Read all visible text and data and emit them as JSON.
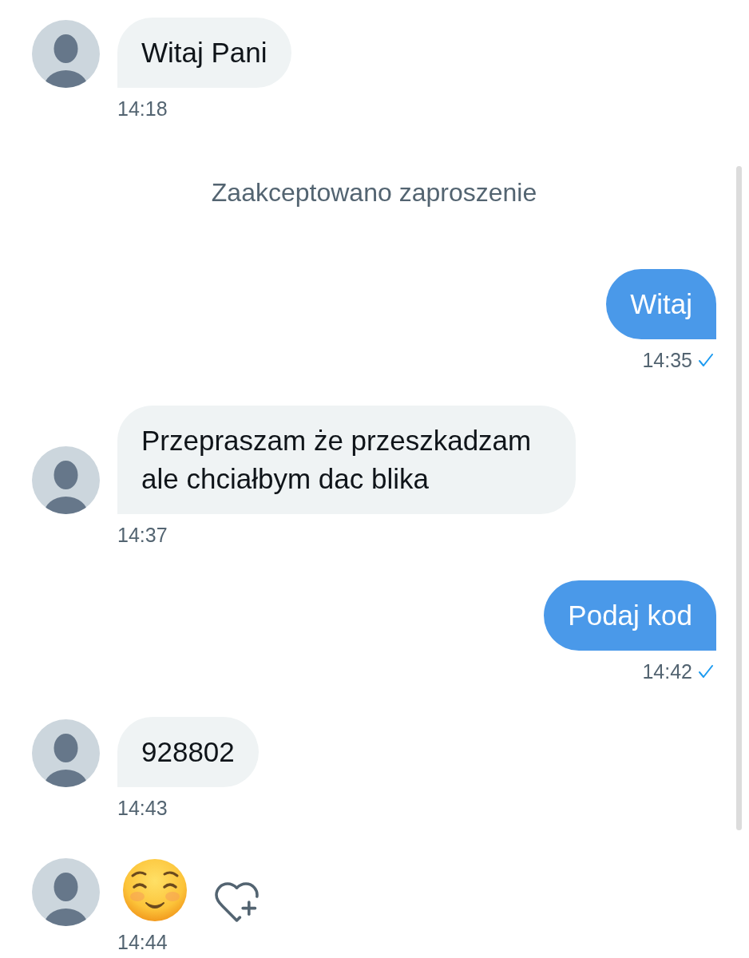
{
  "messages": [
    {
      "kind": "text",
      "outgoing": false,
      "text": "Witaj Pani",
      "time": "14:18"
    },
    {
      "kind": "system",
      "text": "Zaakceptowano zaproszenie"
    },
    {
      "kind": "text",
      "outgoing": true,
      "text": "Witaj",
      "time": "14:35",
      "delivered": true
    },
    {
      "kind": "text",
      "outgoing": false,
      "text": "Przepraszam że przeszkadzam ale chciałbym dac blika",
      "time": "14:37"
    },
    {
      "kind": "text",
      "outgoing": true,
      "text": "Podaj kod",
      "time": "14:42",
      "delivered": true
    },
    {
      "kind": "text",
      "outgoing": false,
      "text": "928802",
      "time": "14:43"
    },
    {
      "kind": "emoji",
      "outgoing": false,
      "time": "14:44",
      "react_button": true
    }
  ]
}
